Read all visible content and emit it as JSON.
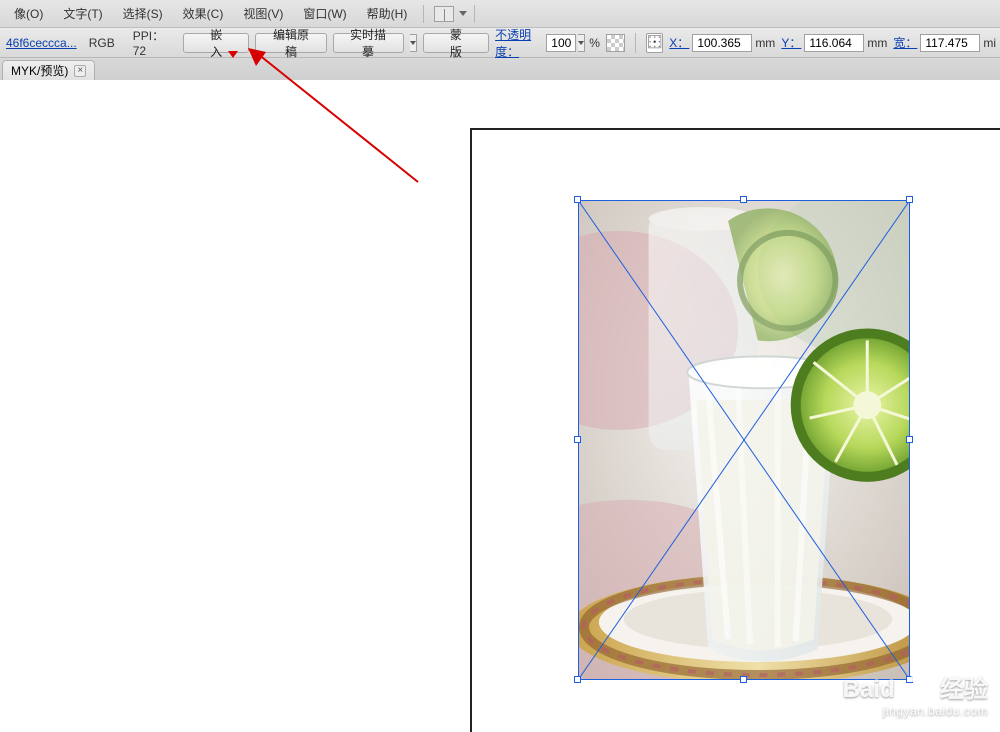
{
  "menu": {
    "image": "像(O)",
    "type": "文字(T)",
    "select": "选择(S)",
    "effect": "效果(C)",
    "view": "视图(V)",
    "window": "窗口(W)",
    "help": "帮助(H)"
  },
  "control": {
    "file": "46f6ceccca...",
    "mode": "RGB",
    "ppi_label": "PPI：72",
    "embed": "嵌入",
    "edit_original": "编辑原稿",
    "live_trace": "实时描摹",
    "mask": "蒙版",
    "opacity_label": "不透明度：",
    "opacity_value": "100",
    "percent": "%",
    "x_label": "X：",
    "x_value": "100.365",
    "x_unit": "mm",
    "y_label": "Y：",
    "y_value": "116.064",
    "y_unit": "mm",
    "w_label": "宽：",
    "w_value": "117.475",
    "w_unit": "mi"
  },
  "tab": {
    "name": "MYK/预览)"
  },
  "watermark": {
    "brand": "Baid",
    "brand2": "经验",
    "sub": "jingyan.baidu.com"
  }
}
